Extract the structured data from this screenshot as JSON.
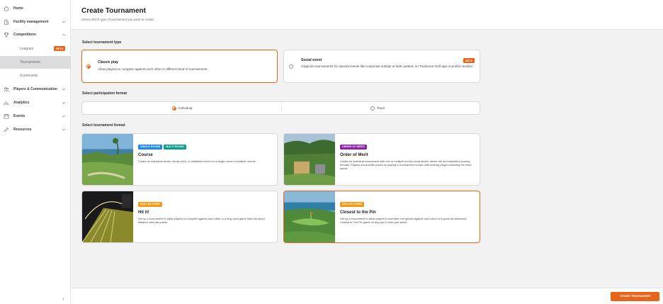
{
  "sidebar": {
    "items": [
      {
        "label": "Home",
        "icon": "home-icon"
      },
      {
        "label": "Facility management",
        "icon": "facility-icon"
      },
      {
        "label": "Competitions",
        "icon": "trophy-icon"
      },
      {
        "label": "Players & Communication",
        "icon": "players-icon"
      },
      {
        "label": "Analytics",
        "icon": "analytics-icon"
      },
      {
        "label": "Events",
        "icon": "calendar-icon"
      },
      {
        "label": "Resources",
        "icon": "link-icon"
      }
    ],
    "sub_items": [
      {
        "label": "Leagues",
        "badge": "BETA"
      },
      {
        "label": "Tournaments"
      },
      {
        "label": "Scorecards"
      }
    ],
    "collapse_glyph": "‹"
  },
  "header": {
    "title": "Create Tournament",
    "subtitle": "Select which type of tournament you want to create"
  },
  "type_section": {
    "label": "Select tournament type",
    "options": [
      {
        "title": "Classic play",
        "desc": "Allow players to compete against each other in different kind of tournaments."
      },
      {
        "title": "Social event",
        "badge": "BETA",
        "desc": "Organize tournaments for special events like corporate outings or kids' parties, no Trackman Golf app or profile needed."
      }
    ]
  },
  "participation": {
    "label": "Select participation format",
    "options": [
      "Individual",
      "Team"
    ]
  },
  "format_section": {
    "label": "Select tournament format",
    "cards": [
      {
        "tags": [
          "SINGLE ROUND",
          "MULTI ROUND"
        ],
        "title": "Course",
        "desc": "Create an individual stroke, stroke (net), or stableford event for a single round or multiple rounds."
      },
      {
        "tags": [
          "ORDER OF MERIT"
        ],
        "title": "Order of Merit",
        "desc": "Create an individual tournament with one or multiple rounds using stroke, stroke net and stableford scoring formats. Players accumulate points by playing in tournament rounds, with winning player collecting the most points."
      },
      {
        "tags": [
          "SKILLED GAME"
        ],
        "title": "Hit it!",
        "desc": "Set up a tournament to allow players to compete against each other in a long drive game that's all about distance and raw power."
      },
      {
        "tags": [
          "SKILLED GAME"
        ],
        "title": "Closest to the Pin",
        "desc": "Set up a tournament to allow players to test their iron games against each other in a good old-fashioned Closest to The Pin game on any par-3 holes you select."
      }
    ]
  },
  "footer": {
    "create_button": "Create Tournament"
  },
  "colors": {
    "accent": "#e8641b",
    "tag_single_round": "#1e88e5",
    "tag_multi_round": "#0f9d8a",
    "tag_order_of_merit": "#8e24aa",
    "tag_skilled_game": "#f39a12"
  }
}
